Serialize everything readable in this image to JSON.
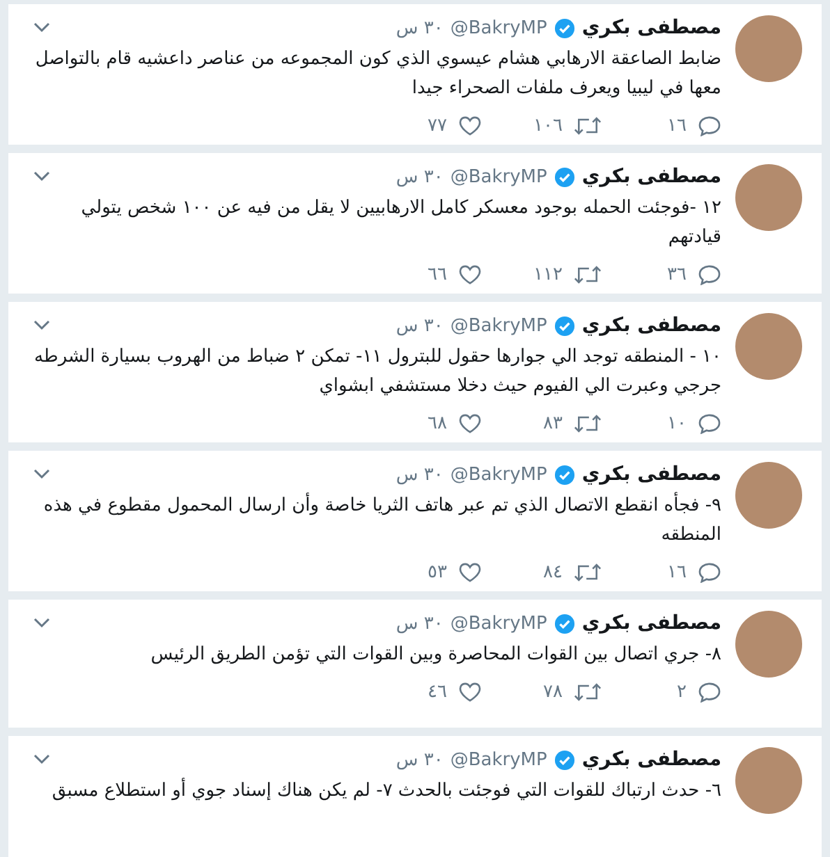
{
  "tweets": [
    {
      "name": "مصطفى بكري",
      "verified": true,
      "handle": "@BakryMP",
      "time": "٣٠ س",
      "text": "ضابط الصاعقة الارهابي هشام عيسوي الذي كون المجموعه من عناصر داعشيه قام بالتواصل معها في ليبيا ويعرف ملفات الصحراء جيدا",
      "stats": {
        "replies": "١٦",
        "retweets": "١٠٦",
        "likes": "٧٧"
      }
    },
    {
      "name": "مصطفى بكري",
      "verified": true,
      "handle": "@BakryMP",
      "time": "٣٠ س",
      "text": "١٢ -فوجئت الحمله بوجود معسكر كامل الارهابيين لا يقل من فيه عن ١٠٠ شخص يتولي قيادتهم",
      "stats": {
        "replies": "٣٦",
        "retweets": "١١٢",
        "likes": "٦٦"
      }
    },
    {
      "name": "مصطفى بكري",
      "verified": true,
      "handle": "@BakryMP",
      "time": "٣٠ س",
      "text": "١٠ - المنطقه توجد الي جوارها حقول للبترول ١١- تمكن ٢ ضباط من الهروب بسيارة الشرطه جرجي وعبرت الي الفيوم حيث دخلا مستشفي ابشواي",
      "stats": {
        "replies": "١٠",
        "retweets": "٨٣",
        "likes": "٦٨"
      }
    },
    {
      "name": "مصطفى بكري",
      "verified": true,
      "handle": "@BakryMP",
      "time": "٣٠ س",
      "text": "٩- فجأه انقطع الاتصال الذي تم عبر هاتف الثريا خاصة وأن ارسال المحمول مقطوع في هذه المنطقه",
      "stats": {
        "replies": "١٦",
        "retweets": "٨٤",
        "likes": "٥٣"
      }
    },
    {
      "name": "مصطفى بكري",
      "verified": true,
      "handle": "@BakryMP",
      "time": "٣٠ س",
      "text": "٨- جري اتصال بين القوات المحاصرة وبين القوات التي تؤمن الطريق الرئيس",
      "stats": {
        "replies": "٢",
        "retweets": "٧٨",
        "likes": "٤٦"
      }
    },
    {
      "name": "مصطفى بكري",
      "verified": true,
      "handle": "@BakryMP",
      "time": "٣٠ س",
      "text": "٦- حدث ارتباك للقوات التي فوجئت بالحدث ٧- لم يكن هناك إسناد جوي أو استطلاع مسبق"
    }
  ]
}
